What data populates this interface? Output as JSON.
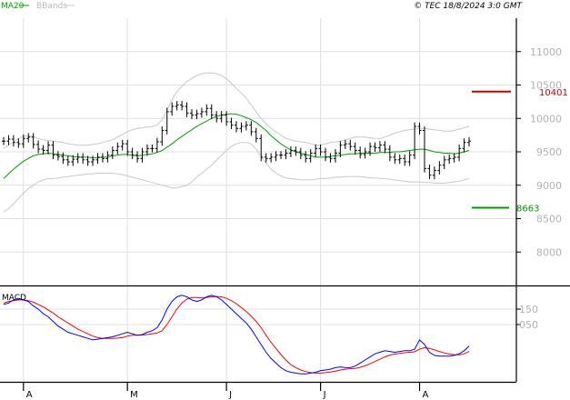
{
  "header": {
    "ma_label": "MA20",
    "bb_label": "BBands",
    "copyright": "© TEC 18/8/2024 3:0 GMT"
  },
  "colors": {
    "ma": "#00a000",
    "bb": "#c8c8c8",
    "price": "#000000",
    "resistance": "#cc0000",
    "support": "#009900",
    "macd": "#0000ff",
    "signal": "#ff0000",
    "grid": "#e0e0e0",
    "panel_bg": "#f4f4f4"
  },
  "macd_panel": {
    "label": "MACD"
  },
  "chart_data": [
    {
      "type": "ohlc",
      "title": "",
      "ylim": [
        7500,
        11500
      ],
      "yticks": [
        8000,
        8500,
        9000,
        9500,
        10000,
        10500,
        11000
      ],
      "ytick_labels": [
        "8000",
        "8500",
        "9000",
        "9500",
        "10000",
        "10500",
        "11000"
      ],
      "xticks": [
        "A",
        "M",
        "J",
        "J",
        "A"
      ],
      "xtick_index": [
        4,
        25,
        45,
        64,
        84
      ],
      "levels": [
        {
          "name": "resistance",
          "value": 10401,
          "label": "10401"
        },
        {
          "name": "support",
          "value": 8663,
          "label": "8663"
        }
      ],
      "close": [
        9660,
        9690,
        9640,
        9620,
        9700,
        9720,
        9610,
        9540,
        9520,
        9600,
        9450,
        9430,
        9380,
        9350,
        9390,
        9420,
        9380,
        9350,
        9380,
        9420,
        9400,
        9450,
        9520,
        9580,
        9620,
        9500,
        9450,
        9400,
        9500,
        9550,
        9550,
        9650,
        9820,
        10100,
        10180,
        10200,
        10180,
        10080,
        10050,
        10070,
        10100,
        10150,
        10050,
        10000,
        10050,
        9950,
        9900,
        9850,
        9880,
        9900,
        9800,
        9700,
        9420,
        9400,
        9420,
        9450,
        9450,
        9480,
        9520,
        9500,
        9450,
        9400,
        9480,
        9550,
        9500,
        9420,
        9400,
        9480,
        9600,
        9620,
        9580,
        9520,
        9460,
        9500,
        9580,
        9560,
        9600,
        9540,
        9420,
        9380,
        9400,
        9350,
        9450,
        9880,
        9820,
        9250,
        9150,
        9220,
        9300,
        9380,
        9400,
        9420,
        9550,
        9640,
        9660
      ],
      "ma20": [
        9100,
        9170,
        9240,
        9300,
        9360,
        9400,
        9440,
        9460,
        9470,
        9480,
        9470,
        9460,
        9450,
        9440,
        9430,
        9420,
        9420,
        9420,
        9410,
        9410,
        9420,
        9420,
        9440,
        9450,
        9460,
        9460,
        9450,
        9440,
        9450,
        9460,
        9470,
        9490,
        9520,
        9570,
        9620,
        9680,
        9730,
        9780,
        9830,
        9880,
        9920,
        9960,
        10000,
        10030,
        10050,
        10060,
        10070,
        10060,
        10040,
        10010,
        9980,
        9940,
        9880,
        9820,
        9740,
        9680,
        9620,
        9570,
        9530,
        9500,
        9480,
        9460,
        9440,
        9420,
        9420,
        9420,
        9430,
        9440,
        9450,
        9460,
        9470,
        9470,
        9480,
        9480,
        9480,
        9480,
        9490,
        9490,
        9490,
        9500,
        9500,
        9510,
        9520,
        9530,
        9540,
        9540,
        9520,
        9500,
        9490,
        9480,
        9480,
        9470,
        9480,
        9500,
        9520
      ],
      "bb_upper": [
        9550,
        9600,
        9650,
        9700,
        9730,
        9740,
        9730,
        9700,
        9680,
        9670,
        9660,
        9650,
        9640,
        9620,
        9610,
        9600,
        9600,
        9600,
        9610,
        9620,
        9640,
        9660,
        9680,
        9720,
        9760,
        9800,
        9830,
        9850,
        9860,
        9870,
        9880,
        9900,
        9980,
        10120,
        10280,
        10400,
        10480,
        10550,
        10600,
        10640,
        10670,
        10680,
        10680,
        10670,
        10640,
        10600,
        10520,
        10450,
        10380,
        10300,
        10200,
        10100,
        10000,
        9920,
        9850,
        9800,
        9750,
        9700,
        9680,
        9660,
        9650,
        9640,
        9620,
        9600,
        9600,
        9620,
        9640,
        9650,
        9660,
        9680,
        9700,
        9720,
        9720,
        9720,
        9710,
        9700,
        9700,
        9720,
        9750,
        9780,
        9800,
        9820,
        9830,
        9840,
        9850,
        9850,
        9840,
        9830,
        9820,
        9810,
        9810,
        9820,
        9840,
        9860,
        9880
      ],
      "bb_lower": [
        8600,
        8650,
        8720,
        8800,
        8880,
        8950,
        9000,
        9050,
        9080,
        9100,
        9100,
        9110,
        9120,
        9130,
        9140,
        9150,
        9160,
        9170,
        9170,
        9180,
        9180,
        9180,
        9180,
        9170,
        9160,
        9140,
        9120,
        9100,
        9080,
        9060,
        9040,
        9020,
        9000,
        8980,
        8960,
        8960,
        8980,
        9000,
        9050,
        9120,
        9180,
        9240,
        9300,
        9380,
        9450,
        9520,
        9580,
        9620,
        9640,
        9640,
        9620,
        9540,
        9430,
        9330,
        9240,
        9180,
        9140,
        9110,
        9100,
        9090,
        9080,
        9080,
        9080,
        9090,
        9100,
        9100,
        9110,
        9120,
        9120,
        9130,
        9130,
        9130,
        9130,
        9120,
        9110,
        9110,
        9100,
        9100,
        9090,
        9080,
        9070,
        9060,
        9050,
        9050,
        9050,
        9040,
        9040,
        9030,
        9030,
        9030,
        9040,
        9050,
        9060,
        9080,
        9100
      ]
    },
    {
      "type": "line",
      "title": "MACD",
      "ylim": [
        -310,
        280
      ],
      "yticks": [
        150,
        50
      ],
      "ytick_labels": [
        "150",
        "050"
      ],
      "series": [
        {
          "name": "MACD",
          "values": [
            180,
            190,
            210,
            220,
            210,
            200,
            170,
            150,
            120,
            100,
            70,
            40,
            20,
            0,
            -10,
            -20,
            -30,
            -40,
            -50,
            -45,
            -40,
            -35,
            -30,
            -20,
            -10,
            0,
            -10,
            -20,
            -15,
            0,
            10,
            30,
            80,
            150,
            200,
            230,
            240,
            230,
            210,
            200,
            210,
            230,
            240,
            230,
            210,
            180,
            150,
            120,
            90,
            60,
            20,
            -30,
            -80,
            -130,
            -170,
            -200,
            -230,
            -250,
            -260,
            -265,
            -270,
            -270,
            -265,
            -260,
            -250,
            -245,
            -240,
            -230,
            -225,
            -230,
            -230,
            -220,
            -200,
            -180,
            -160,
            -140,
            -130,
            -120,
            -125,
            -130,
            -125,
            -120,
            -120,
            -110,
            -50,
            -80,
            -130,
            -150,
            -155,
            -155,
            -155,
            -150,
            -140,
            -120,
            -90
          ]
        },
        {
          "name": "Signal",
          "values": [
            190,
            200,
            205,
            210,
            210,
            205,
            195,
            180,
            165,
            145,
            125,
            100,
            80,
            60,
            40,
            20,
            5,
            -10,
            -25,
            -35,
            -40,
            -40,
            -40,
            -38,
            -35,
            -25,
            -20,
            -20,
            -18,
            -15,
            -10,
            -5,
            10,
            50,
            100,
            150,
            190,
            215,
            225,
            225,
            222,
            225,
            230,
            232,
            230,
            220,
            205,
            185,
            160,
            135,
            105,
            70,
            30,
            -20,
            -65,
            -105,
            -145,
            -180,
            -210,
            -230,
            -245,
            -255,
            -262,
            -265,
            -265,
            -262,
            -258,
            -252,
            -245,
            -240,
            -237,
            -235,
            -228,
            -218,
            -205,
            -190,
            -175,
            -160,
            -148,
            -142,
            -138,
            -133,
            -130,
            -127,
            -110,
            -100,
            -105,
            -115,
            -125,
            -135,
            -142,
            -146,
            -146,
            -140,
            -125
          ]
        }
      ]
    }
  ]
}
